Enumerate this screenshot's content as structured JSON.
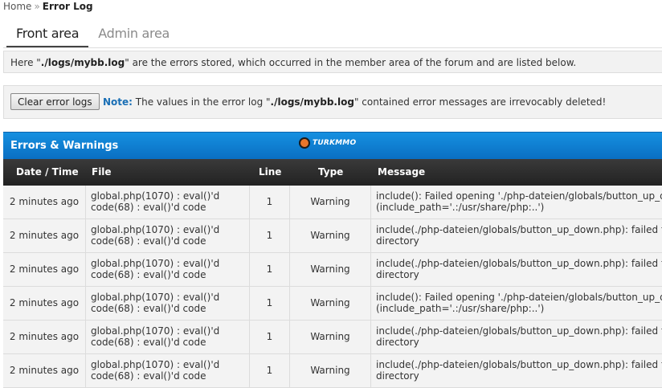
{
  "breadcrumb": {
    "home": "Home",
    "separator": "»",
    "current": "Error Log"
  },
  "tabs": [
    {
      "label": "Front area",
      "active": true
    },
    {
      "label": "Admin area",
      "active": false
    }
  ],
  "info": {
    "prefix": "Here \"",
    "path": "./logs/mybb.log",
    "suffix": "\" are the errors stored, which occurred in the member area of the forum and are listed below."
  },
  "actions": {
    "clear_button": "Clear error logs",
    "note_label": "Note:",
    "note_prefix": " The values in the error log \"",
    "note_path": "./logs/mybb.log",
    "note_suffix": "\" contained error messages are irrevocably deleted!"
  },
  "panel": {
    "title": "Errors & Warnings",
    "logo_text": "TURKMMO",
    "accent": "#0f82d4",
    "logo_color": "#e8762b"
  },
  "table": {
    "headers": {
      "date": "Date / Time",
      "file": "File",
      "line": "Line",
      "type": "Type",
      "message": "Message"
    },
    "rows": [
      {
        "date": "2 minutes ago",
        "file1": "global.php(1070) : eval()'d",
        "file2": "code(68) : eval()'d code",
        "line": "1",
        "type": "Warning",
        "msg1": "include(): Failed opening './php-dateien/globals/button_up_down.php'",
        "msg2": "(include_path='.:/usr/share/php:..')"
      },
      {
        "date": "2 minutes ago",
        "file1": "global.php(1070) : eval()'d",
        "file2": "code(68) : eval()'d code",
        "line": "1",
        "type": "Warning",
        "msg1": "include(./php-dateien/globals/button_up_down.php): failed to open stream: No such file or",
        "msg2": "directory"
      },
      {
        "date": "2 minutes ago",
        "file1": "global.php(1070) : eval()'d",
        "file2": "code(68) : eval()'d code",
        "line": "1",
        "type": "Warning",
        "msg1": "include(./php-dateien/globals/button_up_down.php): failed to open stream: No such file or",
        "msg2": "directory"
      },
      {
        "date": "2 minutes ago",
        "file1": "global.php(1070) : eval()'d",
        "file2": "code(68) : eval()'d code",
        "line": "1",
        "type": "Warning",
        "msg1": "include(): Failed opening './php-dateien/globals/button_up_down.php'",
        "msg2": "(include_path='.:/usr/share/php:..')"
      },
      {
        "date": "2 minutes ago",
        "file1": "global.php(1070) : eval()'d",
        "file2": "code(68) : eval()'d code",
        "line": "1",
        "type": "Warning",
        "msg1": "include(./php-dateien/globals/button_up_down.php): failed to open stream: No such file or",
        "msg2": "directory"
      },
      {
        "date": "2 minutes ago",
        "file1": "global.php(1070) : eval()'d",
        "file2": "code(68) : eval()'d code",
        "line": "1",
        "type": "Warning",
        "msg1": "include(./php-dateien/globals/button_up_down.php): failed to open stream: No such file or",
        "msg2": "directory"
      }
    ]
  }
}
